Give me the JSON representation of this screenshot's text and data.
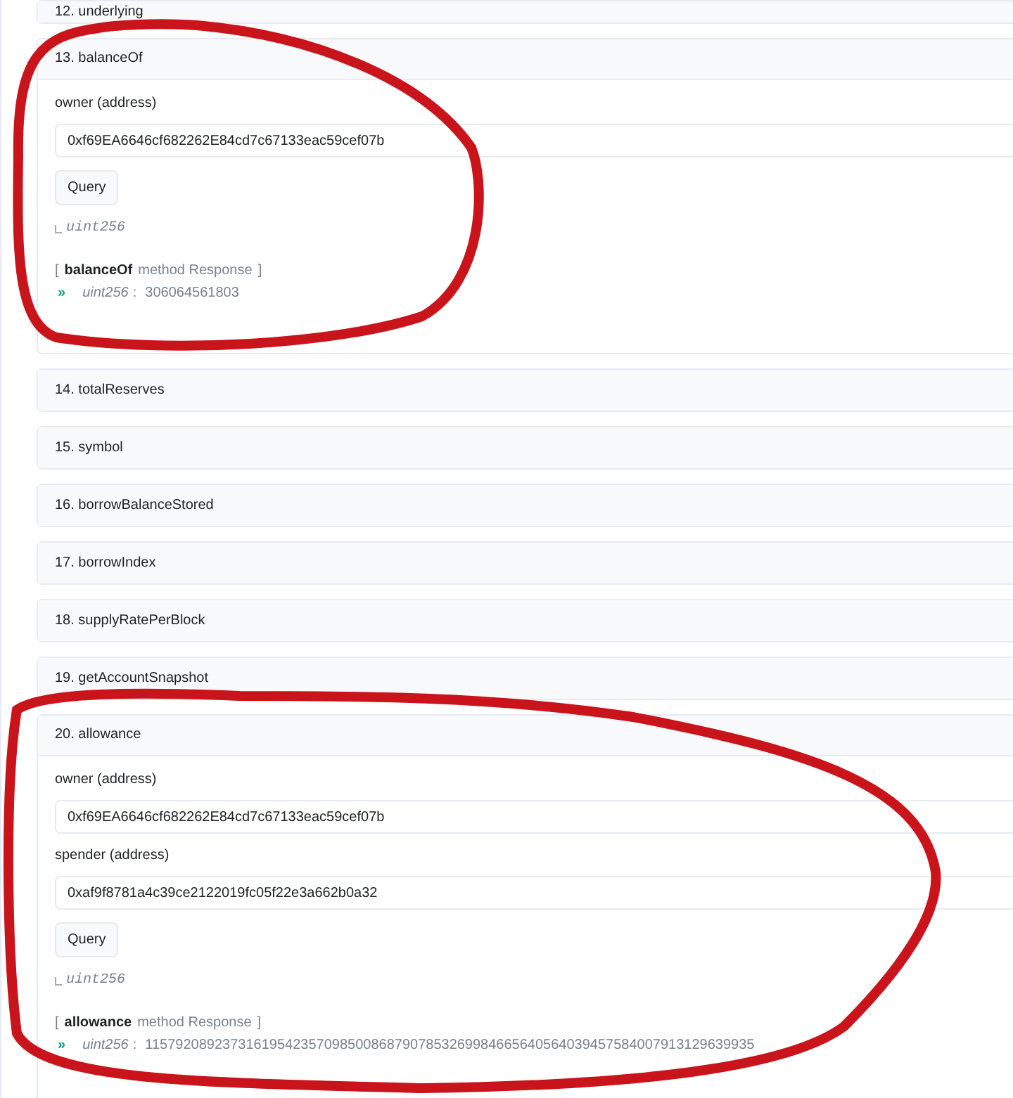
{
  "methods": [
    {
      "title": "12. underlying",
      "expanded": false
    },
    {
      "title": "13. balanceOf",
      "expanded": true,
      "inputs": [
        {
          "label": "owner (address)",
          "value": "0xf69EA6646cf682262E84cd7c67133eac59cef07b"
        }
      ],
      "button": "Query",
      "output_type": "uint256",
      "response": {
        "open": "[",
        "method": "balanceOf",
        "text": "method Response",
        "close": "]",
        "arrow": "»",
        "type": "uint256",
        "colon": ":",
        "value": "306064561803"
      }
    },
    {
      "title": "14. totalReserves",
      "expanded": false
    },
    {
      "title": "15. symbol",
      "expanded": false
    },
    {
      "title": "16. borrowBalanceStored",
      "expanded": false
    },
    {
      "title": "17. borrowIndex",
      "expanded": false
    },
    {
      "title": "18. supplyRatePerBlock",
      "expanded": false
    },
    {
      "title": "19. getAccountSnapshot",
      "expanded": false
    },
    {
      "title": "20. allowance",
      "expanded": true,
      "inputs": [
        {
          "label": "owner (address)",
          "value": "0xf69EA6646cf682262E84cd7c67133eac59cef07b"
        },
        {
          "label": "spender (address)",
          "value": "0xaf9f8781a4c39ce2122019fc05f22e3a662b0a32"
        }
      ],
      "button": "Query",
      "output_type": "uint256",
      "response": {
        "open": "[",
        "method": "allowance",
        "text": "method Response",
        "close": "]",
        "arrow": "»",
        "type": "uint256",
        "colon": ":",
        "value": "115792089237316195423570985008687907853269984665640564039457584007913129639935"
      }
    }
  ]
}
